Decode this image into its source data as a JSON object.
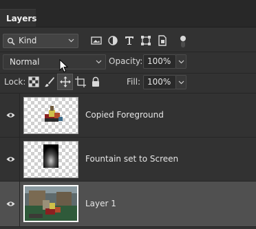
{
  "panel": {
    "tab": "Layers"
  },
  "filter": {
    "kind_label": "Kind",
    "icons": [
      "image-filter-icon",
      "adjustment-filter-icon",
      "type-filter-icon",
      "shape-filter-icon",
      "smart-object-filter-icon"
    ]
  },
  "blend": {
    "mode": "Normal",
    "opacity_label": "Opacity:",
    "opacity_value": "100%"
  },
  "lock": {
    "label": "Lock:",
    "fill_label": "Fill:",
    "fill_value": "100%",
    "icons": [
      "lock-transparent-pixels-icon",
      "lock-image-pixels-icon",
      "lock-position-icon",
      "lock-artboard-icon",
      "lock-all-icon"
    ]
  },
  "layers": [
    {
      "name": "Copied Foreground",
      "visible": true,
      "selected": false
    },
    {
      "name": "Fountain set to Screen",
      "visible": true,
      "selected": false
    },
    {
      "name": "Layer 1",
      "visible": true,
      "selected": true
    }
  ],
  "colors": {
    "panel_bg": "#323232",
    "selected_row": "#505050",
    "tab_bar": "#282828"
  }
}
